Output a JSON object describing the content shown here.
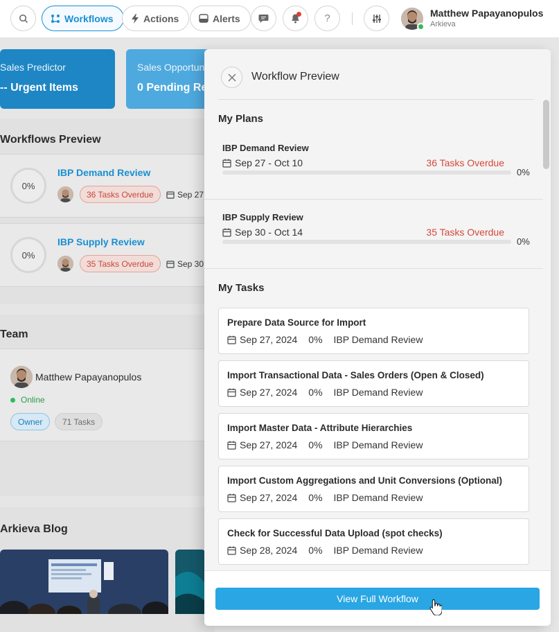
{
  "topbar": {
    "search_icon": "search-icon",
    "workflows_label": "Workflows",
    "actions_label": "Actions",
    "alerts_label": "Alerts",
    "user": {
      "name": "Matthew Papayanopulos",
      "org": "Arkieva",
      "status_color": "#2ebd5b"
    },
    "accent_color": "#1a8fd1"
  },
  "dashboard": {
    "kpis": [
      {
        "title": "Sales Predictor",
        "value": "-- Urgent Items"
      },
      {
        "title": "Sales Opportun",
        "value": "0 Pending Re"
      }
    ],
    "workflows_title": "Workflows Preview",
    "workflows": [
      {
        "progress": "0%",
        "name": "IBP Demand Review",
        "overdue": "36 Tasks Overdue",
        "date": "Sep 27"
      },
      {
        "progress": "0%",
        "name": "IBP Supply Review",
        "overdue": "35 Tasks Overdue",
        "date": "Sep 30"
      }
    ],
    "team_title": "Team",
    "team": {
      "name": "Matthew Papayanopulos",
      "status": "Online",
      "role": "Owner",
      "tasks": "71 Tasks"
    },
    "blog_title": "Arkieva Blog"
  },
  "panel": {
    "title": "Workflow Preview",
    "plans_title": "My Plans",
    "plans": [
      {
        "name": "IBP Demand Review",
        "dates": "Sep 27 - Oct 10",
        "overdue": "36 Tasks Overdue",
        "pct": "0%",
        "progress": 0
      },
      {
        "name": "IBP Supply Review",
        "dates": "Sep 30 - Oct 14",
        "overdue": "35 Tasks Overdue",
        "pct": "0%",
        "progress": 0
      }
    ],
    "tasks_title": "My Tasks",
    "tasks": [
      {
        "name": "Prepare Data Source for Import",
        "date": "Sep 27, 2024",
        "pct": "0%",
        "plan": "IBP Demand Review"
      },
      {
        "name": "Import Transactional Data - Sales Orders (Open & Closed)",
        "date": "Sep 27, 2024",
        "pct": "0%",
        "plan": "IBP Demand Review"
      },
      {
        "name": "Import Master Data - Attribute Hierarchies",
        "date": "Sep 27, 2024",
        "pct": "0%",
        "plan": "IBP Demand Review"
      },
      {
        "name": "Import Custom Aggregations and Unit Conversions (Optional)",
        "date": "Sep 27, 2024",
        "pct": "0%",
        "plan": "IBP Demand Review"
      },
      {
        "name": "Check for Successful Data Upload (spot checks)",
        "date": "Sep 28, 2024",
        "pct": "0%",
        "plan": "IBP Demand Review"
      }
    ],
    "cta_label": "View Full Workflow",
    "overdue_color": "#d4483a",
    "cta_color": "#29a6e3"
  }
}
